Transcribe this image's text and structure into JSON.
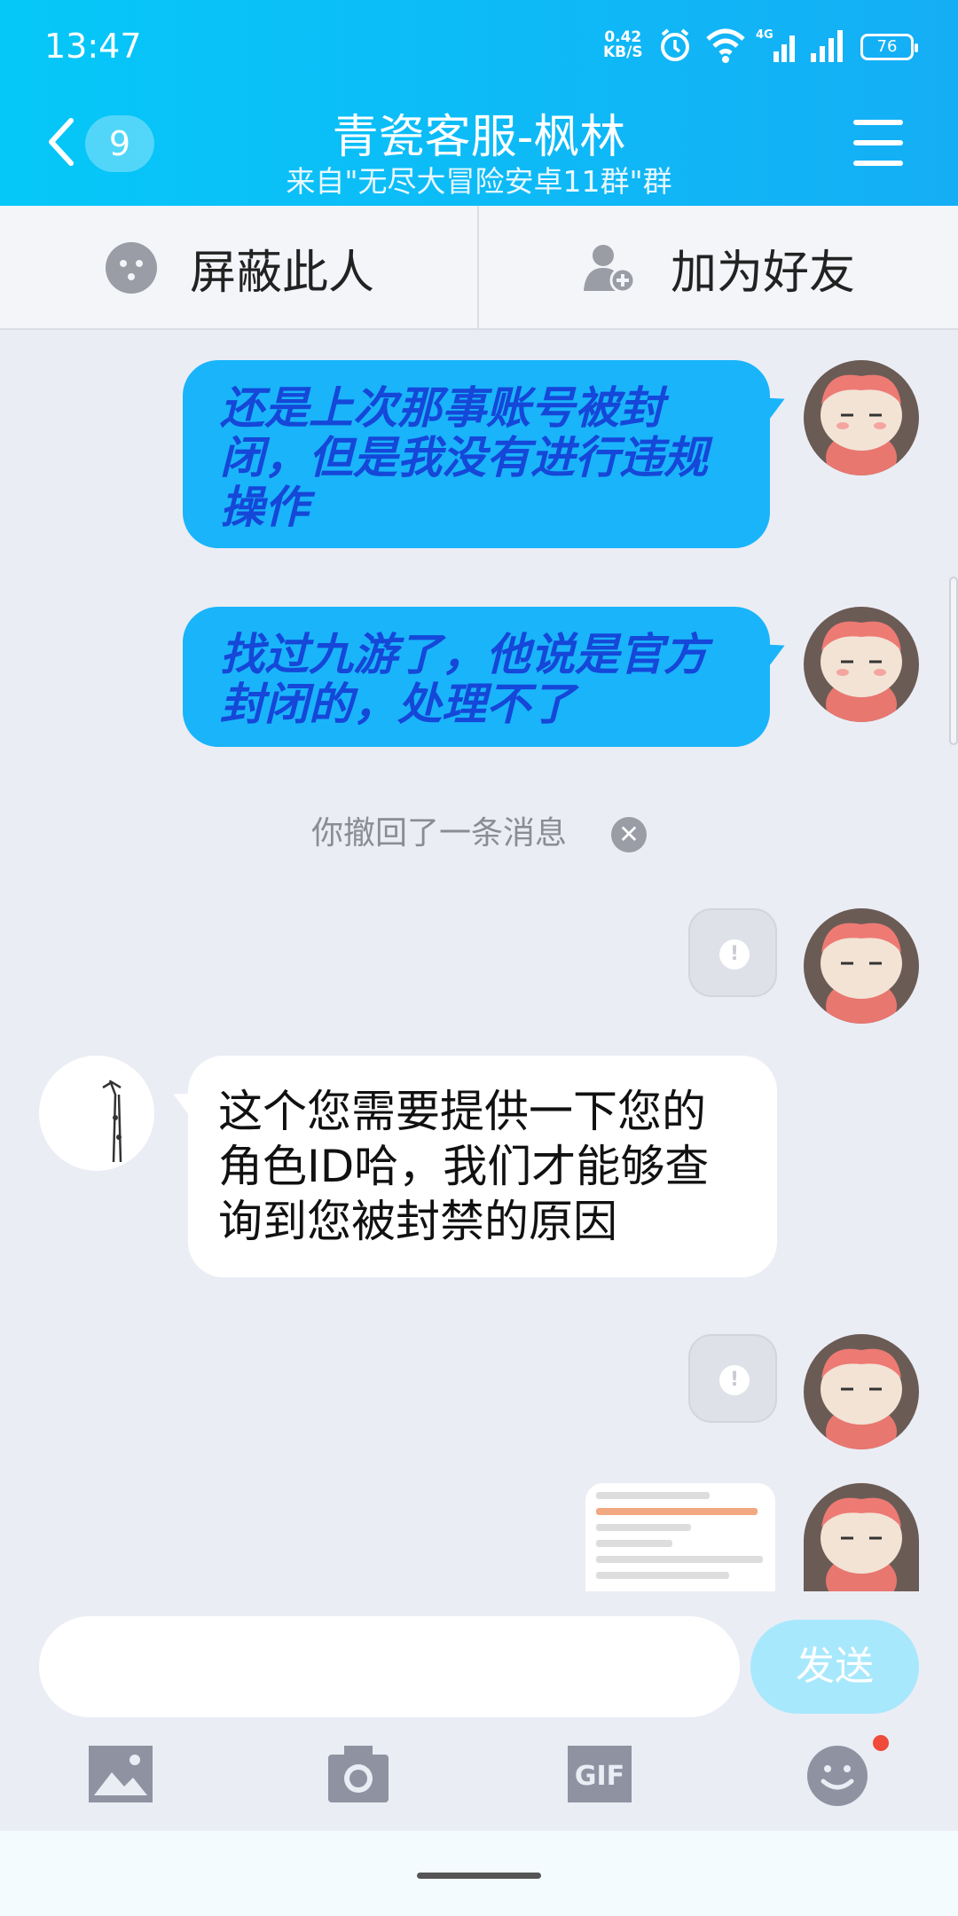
{
  "status_bar": {
    "time": "13:47",
    "net_speed_value": "0.42",
    "net_speed_unit": "KB/S",
    "network": "4G",
    "battery": "76"
  },
  "header": {
    "back_count": "9",
    "title": "青瓷客服-枫林",
    "subtitle": "来自\"无尽大冒险安卓11群\"群"
  },
  "actions": {
    "block_label": "屏蔽此人",
    "add_friend_label": "加为好友"
  },
  "messages": {
    "m1": "还是上次那事账号被封闭，但是我没有进行违规操作",
    "m2": "找过九游了，他说是官方封闭的，处理不了",
    "recall_notice": "你撤回了一条消息",
    "failed_mark": "!",
    "m3": "这个您需要提供一下您的角色ID哈，我们才能够查询到您被封禁的原因"
  },
  "input": {
    "placeholder": "",
    "send_label": "发送"
  },
  "toolbar": {
    "gif_label": "GIF"
  },
  "colors": {
    "accent": "#1ab4fb",
    "header": "#05c8f8",
    "send_disabled": "#a8e8fc"
  }
}
